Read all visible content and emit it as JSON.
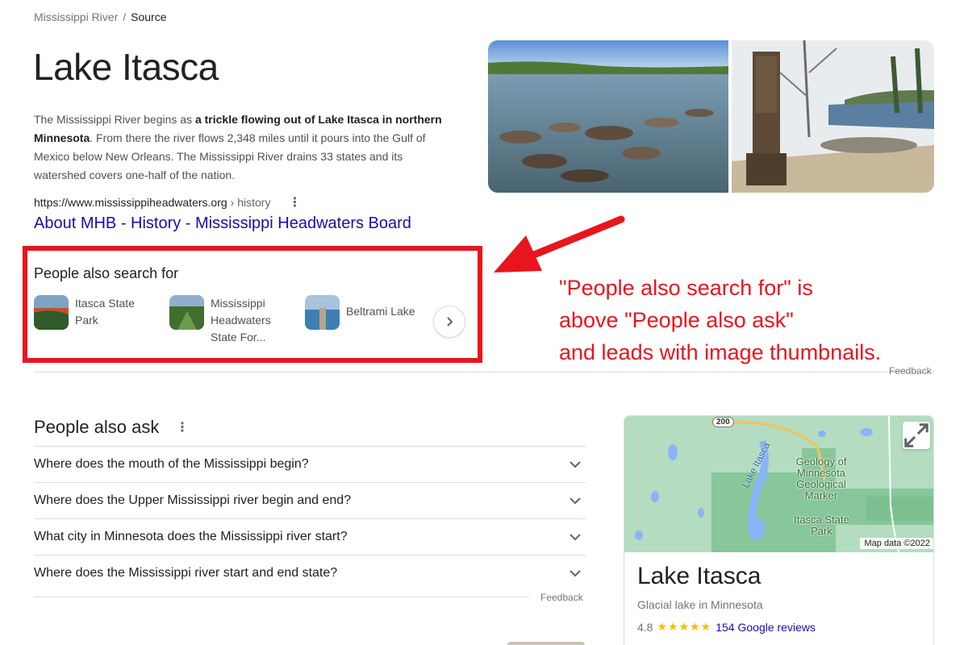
{
  "breadcrumb": {
    "parent": "Mississippi River",
    "separator": "/",
    "current": "Source"
  },
  "page_title": "Lake Itasca",
  "snippet": {
    "part1": "The Mississippi River begins as ",
    "bold": "a trickle flowing out of Lake Itasca in northern Minnesota",
    "part2": ". From there the river flows 2,348 miles until it pours into the Gulf of Mexico below New Orleans. The Mississippi River drains 33 states and its watershed covers one-half of the nation."
  },
  "source": {
    "domain": "https://www.mississippiheadwaters.org",
    "path": "› history",
    "link_text": "About MHB - History - Mississippi Headwaters Board"
  },
  "people_also_search": {
    "title": "People also search for",
    "items": [
      {
        "label": "Itasca State Park"
      },
      {
        "label": "Mississippi Headwaters State For..."
      },
      {
        "label": "Beltrami Lake"
      }
    ]
  },
  "feedback_label": "Feedback",
  "annotation": {
    "line1": "\"People also search for\" is",
    "line2": "above \"People also ask\"",
    "line3": "and leads with image thumbnails."
  },
  "people_also_ask": {
    "title": "People also ask",
    "questions": [
      "Where does the mouth of the Mississippi begin?",
      "Where does the Upper Mississippi river begin and end?",
      "What city in Minnesota does the Mississippi river start?",
      "Where does the Mississippi river start and end state?"
    ]
  },
  "knowledge_panel": {
    "title": "Lake Itasca",
    "subtitle": "Glacial lake in Minnesota",
    "rating": "4.8",
    "stars": "★★★★★",
    "reviews": "154 Google reviews",
    "map": {
      "credit": "Map data ©2022",
      "road_shield": "200",
      "lake_label": "Lake Itasca",
      "marker_label": "Geology of Minnesota Geological Marker",
      "park_label": "Itasca State Park"
    }
  },
  "colors": {
    "link": "#1a0dab",
    "annotation_red": "#e8151c",
    "star_yellow": "#fbbc04",
    "map_green": "#a8dab5",
    "map_water": "#8ab4f8"
  }
}
